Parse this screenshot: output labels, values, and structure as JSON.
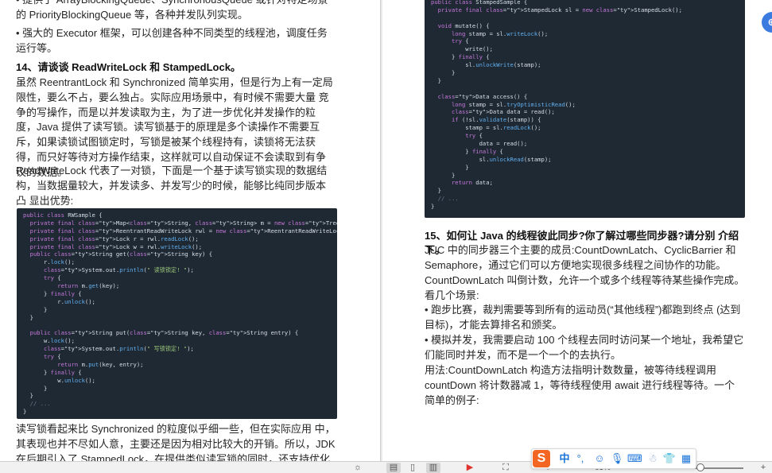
{
  "left_page": {
    "p_top": "• 提供了 ArrayBlockingQueue、SynchronousQueue 或针对特定场景的 PriorityBlockingQueue 等，各种并发队列实现。",
    "p_executor": "• 强大的 Executor 框架，可以创建各种不同类型的线程池，调度任务运行等。",
    "heading_14": "14、请谈谈 ReadWriteLock 和 StampedLock。",
    "p_rwlock_1": "虽然 ReentrantLock 和 Synchronized 简单实用，但是行为上有一定局限性，要么不占，要么独占。实际应用场景中，有时候不需要大量 竞争的写操作，而是以并发读取为主，为了进一步优化并发操作的粒 度，Java 提供了读写锁。读写锁基于的原理是多个读操作不需要互斥，如果读锁试图锁定时，写锁是被某个线程持有，读锁将无法获得，而只好等待对方操作结束，这样就可以自动保证不会读取到有争议的数据。",
    "p_rwlock_2": "ReadWriteLock 代表了一对锁，下面是一个基于读写锁实现的数据结 构，当数据量较大，并发读多、并发写少的时候，能够比纯同步版本凸 显出优势:",
    "p_bottom": "读写锁看起来比 Synchronized 的粒度似乎细一些，但在实际应用 中，其表现也并不尽如人意，主要还是因为相对比较大的开销。所以，JDK 在后期引入了 StampedLock，在提供类似读写锁的同时，还支持优化读模式。"
  },
  "code_rwsample": [
    "public class RWSample {",
    "  private final Map<String, String> m = new TreeMap<>();",
    "  private final ReentrantReadWriteLock rwl = new ReentrantReadWriteLock();",
    "  private final Lock r = rwl.readLock();",
    "  private final Lock w = rwl.writeLock();",
    "  public String get(String key) {",
    "      r.lock();",
    "      System.out.println(\" 读锁锁定! \");",
    "      try {",
    "          return m.get(key);",
    "      } finally {",
    "          r.unlock();",
    "      }",
    "  }",
    "",
    "  public String put(String key, String entry) {",
    "      w.lock();",
    "      System.out.println(\" 写锁锁定! \");",
    "      try {",
    "          return m.put(key, entry);",
    "      } finally {",
    "          w.unlock();",
    "      }",
    "  }",
    "  // ...",
    "}"
  ],
  "code_stamped": [
    "public class StampedSample {",
    "  private final StampedLock sl = new StampedLock();",
    "",
    "  void mutate() {",
    "      long stamp = sl.writeLock();",
    "      try {",
    "          write();",
    "      } finally {",
    "          sl.unlockWrite(stamp);",
    "      }",
    "  }",
    "",
    "  Data access() {",
    "      long stamp = sl.tryOptimisticRead();",
    "      Data data = read();",
    "      if (!sl.validate(stamp)) {",
    "          stamp = sl.readLock();",
    "          try {",
    "              data = read();",
    "          } finally {",
    "              sl.unlockRead(stamp);",
    "          }",
    "      }",
    "      return data;",
    "  }",
    "  // ...",
    "}"
  ],
  "right_page": {
    "heading_15": "15、如何让 Java 的线程彼此同步?你了解过哪些同步器?请分别 介绍下。",
    "p_juc": "JUC 中的同步器三个主要的成员:CountDownLatch、CyclicBarrier 和 Semaphore，通过它们可以方便地实现很多线程之间协作的功能。",
    "p_cdl": "CountDownLatch 叫倒计数，允许一个或多个线程等待某些操作完成。看几个场景:",
    "p_race": "• 跑步比赛，裁判需要等到所有的运动员(“其他线程”)都跑到终点 (达到目标)，才能去算排名和颁奖。",
    "p_sim": "• 模拟并发，我需要启动 100 个线程去同时访问某一个地址，我希望它 们能同时并发，而不是一个一个的去执行。",
    "p_usage": "用法:CountDownLatch 构造方法指明计数数量，被等待线程调用 countDown 将计数器减 1，等待线程使用 await 进行线程等待。一个简单的例子:"
  },
  "toolbar": {
    "zoom_text": "63%",
    "icons": [
      "brightness-icon",
      "single-page-icon",
      "continuous-page-icon",
      "two-page-icon",
      "play-icon",
      "fit-width-icon",
      "rotate-icon"
    ]
  },
  "ime_bar": {
    "logo": "S",
    "mode": "中",
    "punct": "°,",
    "items": [
      "emoji-icon",
      "mic-icon",
      "keyboard-icon",
      "user-icon",
      "skin-icon",
      "grid-icon"
    ]
  },
  "colors": {
    "code_bg": "#1f2933",
    "keyword": "#c678dd",
    "type": "#e5c07b",
    "method": "#61afef",
    "string": "#98c379",
    "ime_orange": "#f26522",
    "badge_blue": "#3b7be0"
  }
}
